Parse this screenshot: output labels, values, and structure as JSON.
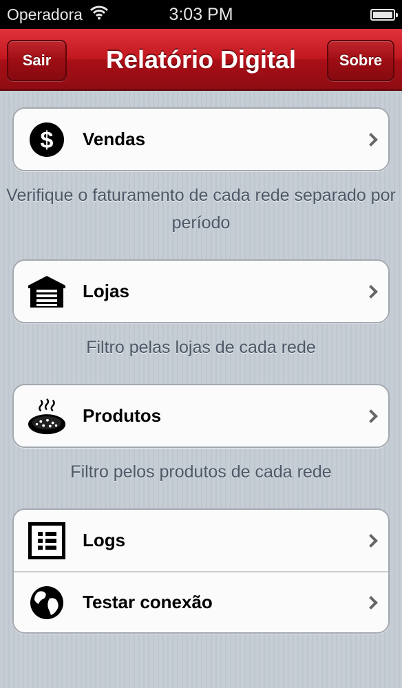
{
  "status_bar": {
    "carrier": "Operadora",
    "time": "3:03 PM"
  },
  "nav": {
    "title": "Relatório Digital",
    "left_button": "Sair",
    "right_button": "Sobre"
  },
  "menu": {
    "vendas": {
      "label": "Vendas",
      "icon": "dollar-icon",
      "description": "Verifique o faturamento de cada rede separado por período"
    },
    "lojas": {
      "label": "Lojas",
      "icon": "store-icon",
      "description": "Filtro pelas lojas de cada rede"
    },
    "produtos": {
      "label": "Produtos",
      "icon": "pizza-icon",
      "description": "Filtro pelos produtos de cada rede"
    },
    "logs": {
      "label": "Logs",
      "icon": "list-icon"
    },
    "testar": {
      "label": "Testar conexão",
      "icon": "globe-icon"
    }
  },
  "colors": {
    "nav_red": "#c31820",
    "background": "#c5ccd4",
    "description_text": "#4d5766"
  }
}
